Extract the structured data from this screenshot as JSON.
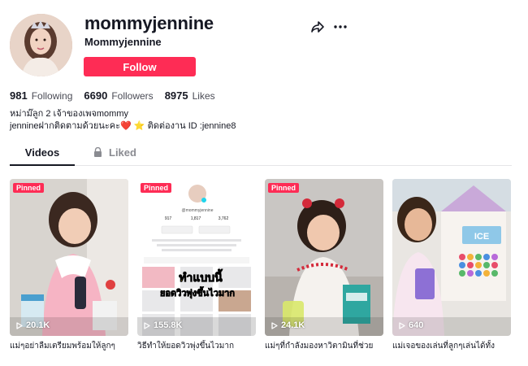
{
  "profile": {
    "username": "mommyjennine",
    "nickname": "Mommyjennine",
    "follow_label": "Follow",
    "bio_line1": "หม่าม๊ลูก 2 เจ้าของเพจmommy",
    "bio_line2": "jennineฝากติดตามด้วยนะคะ❤️ ⭐ ติดต่องาน ID :jennine8"
  },
  "stats": [
    {
      "value": "981",
      "label": "Following"
    },
    {
      "value": "6690",
      "label": "Followers"
    },
    {
      "value": "8975",
      "label": "Likes"
    }
  ],
  "tabs": {
    "videos": "Videos",
    "liked": "Liked"
  },
  "videos": [
    {
      "pinned": "Pinned",
      "views": "20.1K",
      "caption": "แม่ๆอย่าลืมเตรียมพร้อมให้ลูกๆ"
    },
    {
      "pinned": "Pinned",
      "views": "155.8K",
      "caption": "วิธีทำให้ยอดวิวพุ่งขึ้นไวมาก"
    },
    {
      "pinned": "Pinned",
      "views": "24.1K",
      "caption": "แม่ๆที่กำลังมองหาวิตามินที่ช่วย"
    },
    {
      "pinned": "",
      "views": "640",
      "caption": "แม่เจอของเล่นที่ลูกๆเล่นได้ทั้ง"
    }
  ],
  "thumb_text": {
    "v2_line1": "ทำแบบนี้",
    "v2_line2": "ยอดวิวพุ่งขึ้นไวมาก",
    "v2_handle": "@mommyjennine",
    "v2_s1": "917",
    "v2_s2": "1,817",
    "v2_s3": "3,762",
    "v4_label": "ICE"
  },
  "colors": {
    "accent": "#fe2c55",
    "text": "#161823",
    "muted": "#8a8b91"
  },
  "icons": [
    "share-icon",
    "more-icon",
    "lock-icon",
    "play-icon"
  ]
}
